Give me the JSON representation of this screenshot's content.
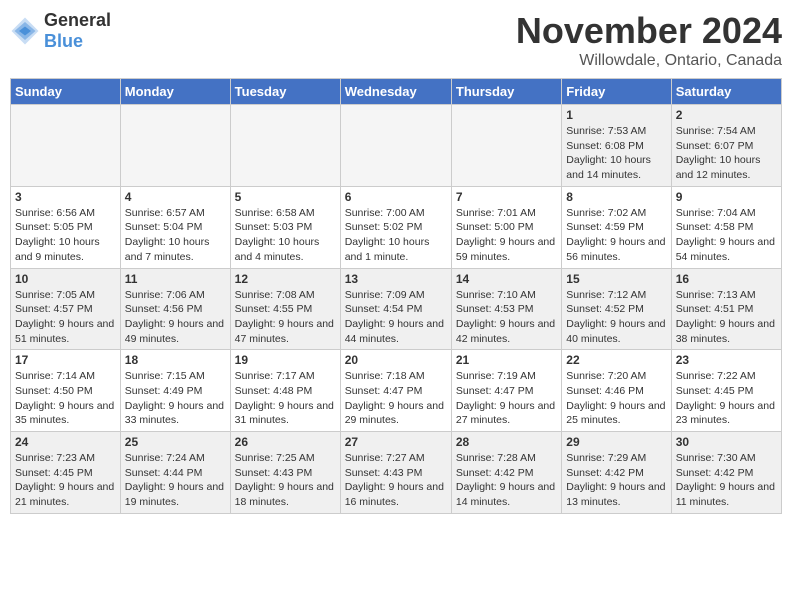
{
  "header": {
    "logo_general": "General",
    "logo_blue": "Blue",
    "month": "November 2024",
    "location": "Willowdale, Ontario, Canada"
  },
  "days_of_week": [
    "Sunday",
    "Monday",
    "Tuesday",
    "Wednesday",
    "Thursday",
    "Friday",
    "Saturday"
  ],
  "weeks": [
    [
      {
        "day": "",
        "info": ""
      },
      {
        "day": "",
        "info": ""
      },
      {
        "day": "",
        "info": ""
      },
      {
        "day": "",
        "info": ""
      },
      {
        "day": "",
        "info": ""
      },
      {
        "day": "1",
        "info": "Sunrise: 7:53 AM\nSunset: 6:08 PM\nDaylight: 10 hours and 14 minutes."
      },
      {
        "day": "2",
        "info": "Sunrise: 7:54 AM\nSunset: 6:07 PM\nDaylight: 10 hours and 12 minutes."
      }
    ],
    [
      {
        "day": "3",
        "info": "Sunrise: 6:56 AM\nSunset: 5:05 PM\nDaylight: 10 hours and 9 minutes."
      },
      {
        "day": "4",
        "info": "Sunrise: 6:57 AM\nSunset: 5:04 PM\nDaylight: 10 hours and 7 minutes."
      },
      {
        "day": "5",
        "info": "Sunrise: 6:58 AM\nSunset: 5:03 PM\nDaylight: 10 hours and 4 minutes."
      },
      {
        "day": "6",
        "info": "Sunrise: 7:00 AM\nSunset: 5:02 PM\nDaylight: 10 hours and 1 minute."
      },
      {
        "day": "7",
        "info": "Sunrise: 7:01 AM\nSunset: 5:00 PM\nDaylight: 9 hours and 59 minutes."
      },
      {
        "day": "8",
        "info": "Sunrise: 7:02 AM\nSunset: 4:59 PM\nDaylight: 9 hours and 56 minutes."
      },
      {
        "day": "9",
        "info": "Sunrise: 7:04 AM\nSunset: 4:58 PM\nDaylight: 9 hours and 54 minutes."
      }
    ],
    [
      {
        "day": "10",
        "info": "Sunrise: 7:05 AM\nSunset: 4:57 PM\nDaylight: 9 hours and 51 minutes."
      },
      {
        "day": "11",
        "info": "Sunrise: 7:06 AM\nSunset: 4:56 PM\nDaylight: 9 hours and 49 minutes."
      },
      {
        "day": "12",
        "info": "Sunrise: 7:08 AM\nSunset: 4:55 PM\nDaylight: 9 hours and 47 minutes."
      },
      {
        "day": "13",
        "info": "Sunrise: 7:09 AM\nSunset: 4:54 PM\nDaylight: 9 hours and 44 minutes."
      },
      {
        "day": "14",
        "info": "Sunrise: 7:10 AM\nSunset: 4:53 PM\nDaylight: 9 hours and 42 minutes."
      },
      {
        "day": "15",
        "info": "Sunrise: 7:12 AM\nSunset: 4:52 PM\nDaylight: 9 hours and 40 minutes."
      },
      {
        "day": "16",
        "info": "Sunrise: 7:13 AM\nSunset: 4:51 PM\nDaylight: 9 hours and 38 minutes."
      }
    ],
    [
      {
        "day": "17",
        "info": "Sunrise: 7:14 AM\nSunset: 4:50 PM\nDaylight: 9 hours and 35 minutes."
      },
      {
        "day": "18",
        "info": "Sunrise: 7:15 AM\nSunset: 4:49 PM\nDaylight: 9 hours and 33 minutes."
      },
      {
        "day": "19",
        "info": "Sunrise: 7:17 AM\nSunset: 4:48 PM\nDaylight: 9 hours and 31 minutes."
      },
      {
        "day": "20",
        "info": "Sunrise: 7:18 AM\nSunset: 4:47 PM\nDaylight: 9 hours and 29 minutes."
      },
      {
        "day": "21",
        "info": "Sunrise: 7:19 AM\nSunset: 4:47 PM\nDaylight: 9 hours and 27 minutes."
      },
      {
        "day": "22",
        "info": "Sunrise: 7:20 AM\nSunset: 4:46 PM\nDaylight: 9 hours and 25 minutes."
      },
      {
        "day": "23",
        "info": "Sunrise: 7:22 AM\nSunset: 4:45 PM\nDaylight: 9 hours and 23 minutes."
      }
    ],
    [
      {
        "day": "24",
        "info": "Sunrise: 7:23 AM\nSunset: 4:45 PM\nDaylight: 9 hours and 21 minutes."
      },
      {
        "day": "25",
        "info": "Sunrise: 7:24 AM\nSunset: 4:44 PM\nDaylight: 9 hours and 19 minutes."
      },
      {
        "day": "26",
        "info": "Sunrise: 7:25 AM\nSunset: 4:43 PM\nDaylight: 9 hours and 18 minutes."
      },
      {
        "day": "27",
        "info": "Sunrise: 7:27 AM\nSunset: 4:43 PM\nDaylight: 9 hours and 16 minutes."
      },
      {
        "day": "28",
        "info": "Sunrise: 7:28 AM\nSunset: 4:42 PM\nDaylight: 9 hours and 14 minutes."
      },
      {
        "day": "29",
        "info": "Sunrise: 7:29 AM\nSunset: 4:42 PM\nDaylight: 9 hours and 13 minutes."
      },
      {
        "day": "30",
        "info": "Sunrise: 7:30 AM\nSunset: 4:42 PM\nDaylight: 9 hours and 11 minutes."
      }
    ]
  ]
}
